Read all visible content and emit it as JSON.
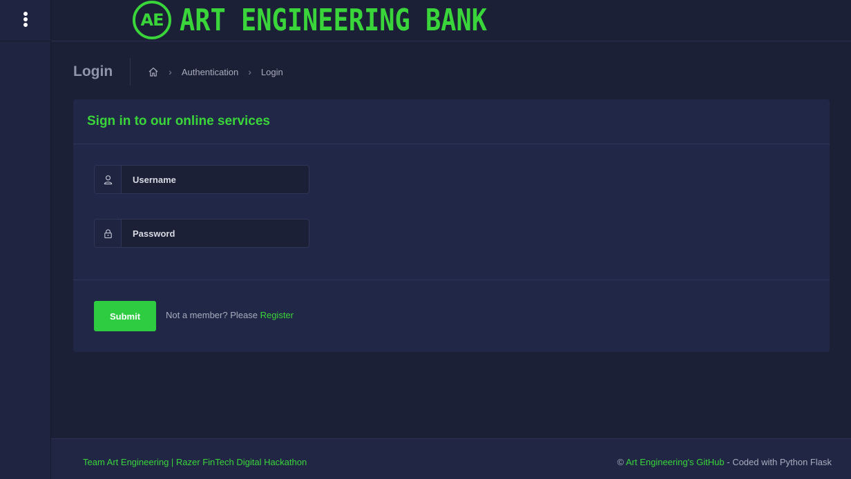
{
  "brand": {
    "logo_text": "AE",
    "name": "ART ENGINEERING BANK",
    "color": "#3ad53a"
  },
  "page": {
    "title": "Login"
  },
  "breadcrumb": {
    "items": [
      "Authentication",
      "Login"
    ]
  },
  "card": {
    "title": "Sign in to our online services",
    "username": {
      "placeholder": "Username",
      "value": ""
    },
    "password": {
      "placeholder": "Password",
      "value": ""
    },
    "submit_label": "Submit",
    "member_text": "Not a member? Please ",
    "register_link": "Register"
  },
  "footer": {
    "left": {
      "team_link": "Team Art Engineering",
      "separator": " | ",
      "event_link": "Razer FinTech Digital Hackathon"
    },
    "right": {
      "copyright": "© ",
      "github_link": "Art Engineering's GitHub",
      "suffix": " - Coded with Python Flask"
    }
  },
  "colors": {
    "accent": "#3ad53a",
    "button": "#2ecc40",
    "background": "#1b2036",
    "panel": "#212746"
  },
  "icons": [
    "kebab-menu-icon",
    "home-icon",
    "chevron-right-icon",
    "user-icon",
    "lock-icon"
  ]
}
